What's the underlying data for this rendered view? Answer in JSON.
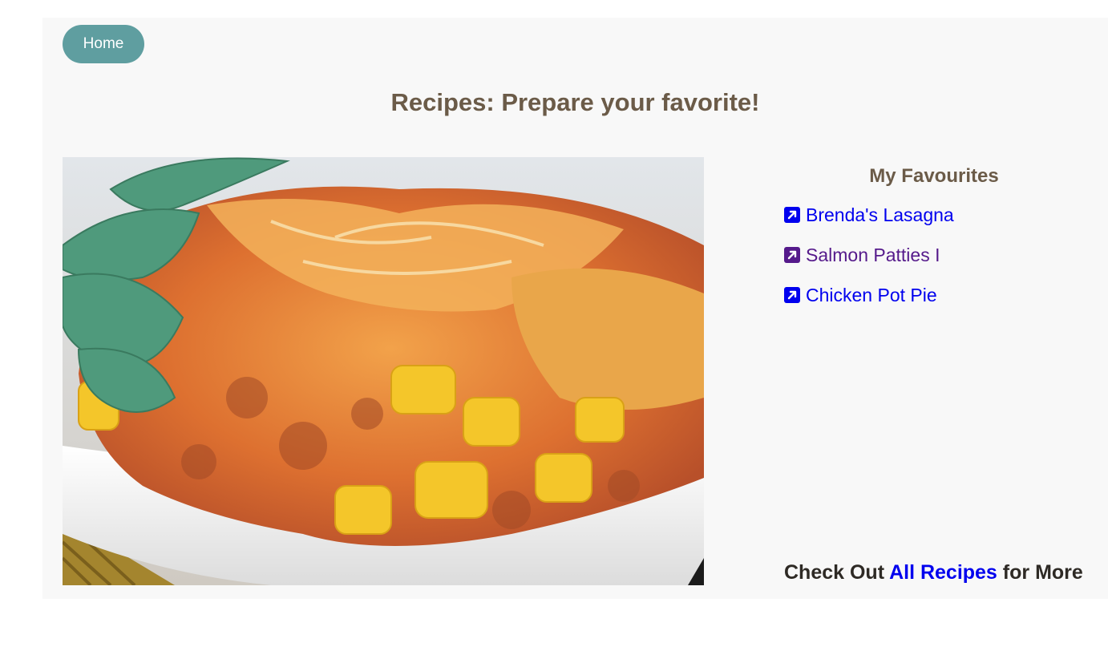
{
  "nav": {
    "home_label": "Home"
  },
  "header": {
    "title": "Recipes: Prepare your favorite!"
  },
  "hero_image": {
    "description_icon": "food-photo"
  },
  "favourites": {
    "title": "My Favourites",
    "items": [
      {
        "label": "Brenda's Lasagna",
        "visited": false
      },
      {
        "label": "Salmon Patties I",
        "visited": true
      },
      {
        "label": "Chicken Pot Pie",
        "visited": false
      }
    ]
  },
  "footer": {
    "prefix": "Check Out",
    "link_label": "All Recipes",
    "suffix": "for More"
  },
  "colors": {
    "home_button": "#5f9ea0",
    "heading": "#6b5b48",
    "link": "#0000ee",
    "visited_link": "#551a8b",
    "panel_background": "#f8f8f8"
  }
}
